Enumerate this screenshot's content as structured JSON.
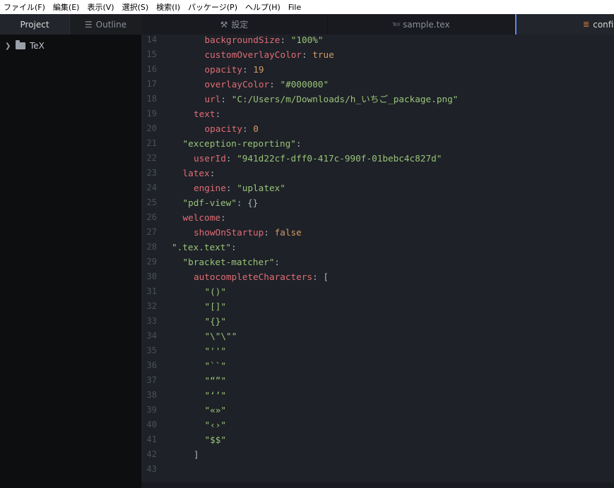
{
  "menubar": {
    "items": [
      "ファイル(F)",
      "編集(E)",
      "表示(V)",
      "選択(S)",
      "検索(I)",
      "パッケージ(P)",
      "ヘルプ(H)",
      "File"
    ]
  },
  "sidebar": {
    "tabs": {
      "project": "Project",
      "outline": "Outline"
    },
    "tree": [
      {
        "label": "TeX"
      }
    ]
  },
  "editor": {
    "tabs": {
      "settings": "設定",
      "sample": "sample.tex",
      "config": "config"
    },
    "tex_badge": "TeX"
  },
  "code": {
    "lines": [
      {
        "n": "14",
        "i": 3,
        "t": [
          [
            "k",
            "backgroundSize"
          ],
          [
            "p",
            ": "
          ],
          [
            "s",
            "\"100%\""
          ]
        ]
      },
      {
        "n": "15",
        "i": 3,
        "t": [
          [
            "k",
            "customOverlayColor"
          ],
          [
            "p",
            ": "
          ],
          [
            "n",
            "true"
          ]
        ]
      },
      {
        "n": "16",
        "i": 3,
        "t": [
          [
            "k",
            "opacity"
          ],
          [
            "p",
            ": "
          ],
          [
            "n",
            "19"
          ]
        ]
      },
      {
        "n": "17",
        "i": 3,
        "t": [
          [
            "k",
            "overlayColor"
          ],
          [
            "p",
            ": "
          ],
          [
            "s",
            "\"#000000\""
          ]
        ]
      },
      {
        "n": "18",
        "i": 3,
        "t": [
          [
            "k",
            "url"
          ],
          [
            "p",
            ": "
          ],
          [
            "s",
            "\"C:/Users/m/Downloads/h_いちご_package.png\""
          ]
        ]
      },
      {
        "n": "19",
        "i": 2,
        "t": [
          [
            "k",
            "text"
          ],
          [
            "p",
            ":"
          ]
        ]
      },
      {
        "n": "20",
        "i": 3,
        "t": [
          [
            "k",
            "opacity"
          ],
          [
            "p",
            ": "
          ],
          [
            "n",
            "0"
          ]
        ]
      },
      {
        "n": "21",
        "i": 1,
        "t": [
          [
            "s",
            "\"exception-reporting\""
          ],
          [
            "p",
            ":"
          ]
        ]
      },
      {
        "n": "22",
        "i": 2,
        "t": [
          [
            "k",
            "userId"
          ],
          [
            "p",
            ": "
          ],
          [
            "s",
            "\"941d22cf-dff0-417c-990f-01bebc4c827d\""
          ]
        ]
      },
      {
        "n": "23",
        "i": 1,
        "t": [
          [
            "k",
            "latex"
          ],
          [
            "p",
            ":"
          ]
        ]
      },
      {
        "n": "24",
        "i": 2,
        "t": [
          [
            "k",
            "engine"
          ],
          [
            "p",
            ": "
          ],
          [
            "s",
            "\"uplatex\""
          ]
        ]
      },
      {
        "n": "25",
        "i": 1,
        "t": [
          [
            "s",
            "\"pdf-view\""
          ],
          [
            "p",
            ": {}"
          ]
        ]
      },
      {
        "n": "26",
        "i": 1,
        "t": [
          [
            "k",
            "welcome"
          ],
          [
            "p",
            ":"
          ]
        ]
      },
      {
        "n": "27",
        "i": 2,
        "t": [
          [
            "k",
            "showOnStartup"
          ],
          [
            "p",
            ": "
          ],
          [
            "n",
            "false"
          ]
        ]
      },
      {
        "n": "28",
        "i": 0,
        "t": [
          [
            "s",
            "\".tex.text\""
          ],
          [
            "p",
            ":"
          ]
        ]
      },
      {
        "n": "29",
        "i": 1,
        "t": [
          [
            "s",
            "\"bracket-matcher\""
          ],
          [
            "p",
            ":"
          ]
        ]
      },
      {
        "n": "30",
        "i": 2,
        "t": [
          [
            "k",
            "autocompleteCharacters"
          ],
          [
            "p",
            ": ["
          ]
        ]
      },
      {
        "n": "31",
        "i": 3,
        "t": [
          [
            "s",
            "\"()\""
          ]
        ]
      },
      {
        "n": "32",
        "i": 3,
        "t": [
          [
            "s",
            "\"[]\""
          ]
        ]
      },
      {
        "n": "33",
        "i": 3,
        "t": [
          [
            "s",
            "\"{}\""
          ]
        ]
      },
      {
        "n": "34",
        "i": 3,
        "t": [
          [
            "s",
            "\"\\\"\\\"\""
          ]
        ]
      },
      {
        "n": "35",
        "i": 3,
        "t": [
          [
            "s",
            "\"''\""
          ]
        ]
      },
      {
        "n": "36",
        "i": 3,
        "t": [
          [
            "s",
            "\"``\""
          ]
        ]
      },
      {
        "n": "37",
        "i": 3,
        "t": [
          [
            "s",
            "\"“”\""
          ]
        ]
      },
      {
        "n": "38",
        "i": 3,
        "t": [
          [
            "s",
            "\"‘’\""
          ]
        ]
      },
      {
        "n": "39",
        "i": 3,
        "t": [
          [
            "s",
            "\"«»\""
          ]
        ]
      },
      {
        "n": "40",
        "i": 3,
        "t": [
          [
            "s",
            "\"‹›\""
          ]
        ]
      },
      {
        "n": "41",
        "i": 3,
        "t": [
          [
            "s",
            "\"$$\""
          ]
        ]
      },
      {
        "n": "42",
        "i": 2,
        "t": [
          [
            "p",
            "]"
          ]
        ]
      },
      {
        "n": "43",
        "i": 0,
        "t": []
      }
    ]
  }
}
